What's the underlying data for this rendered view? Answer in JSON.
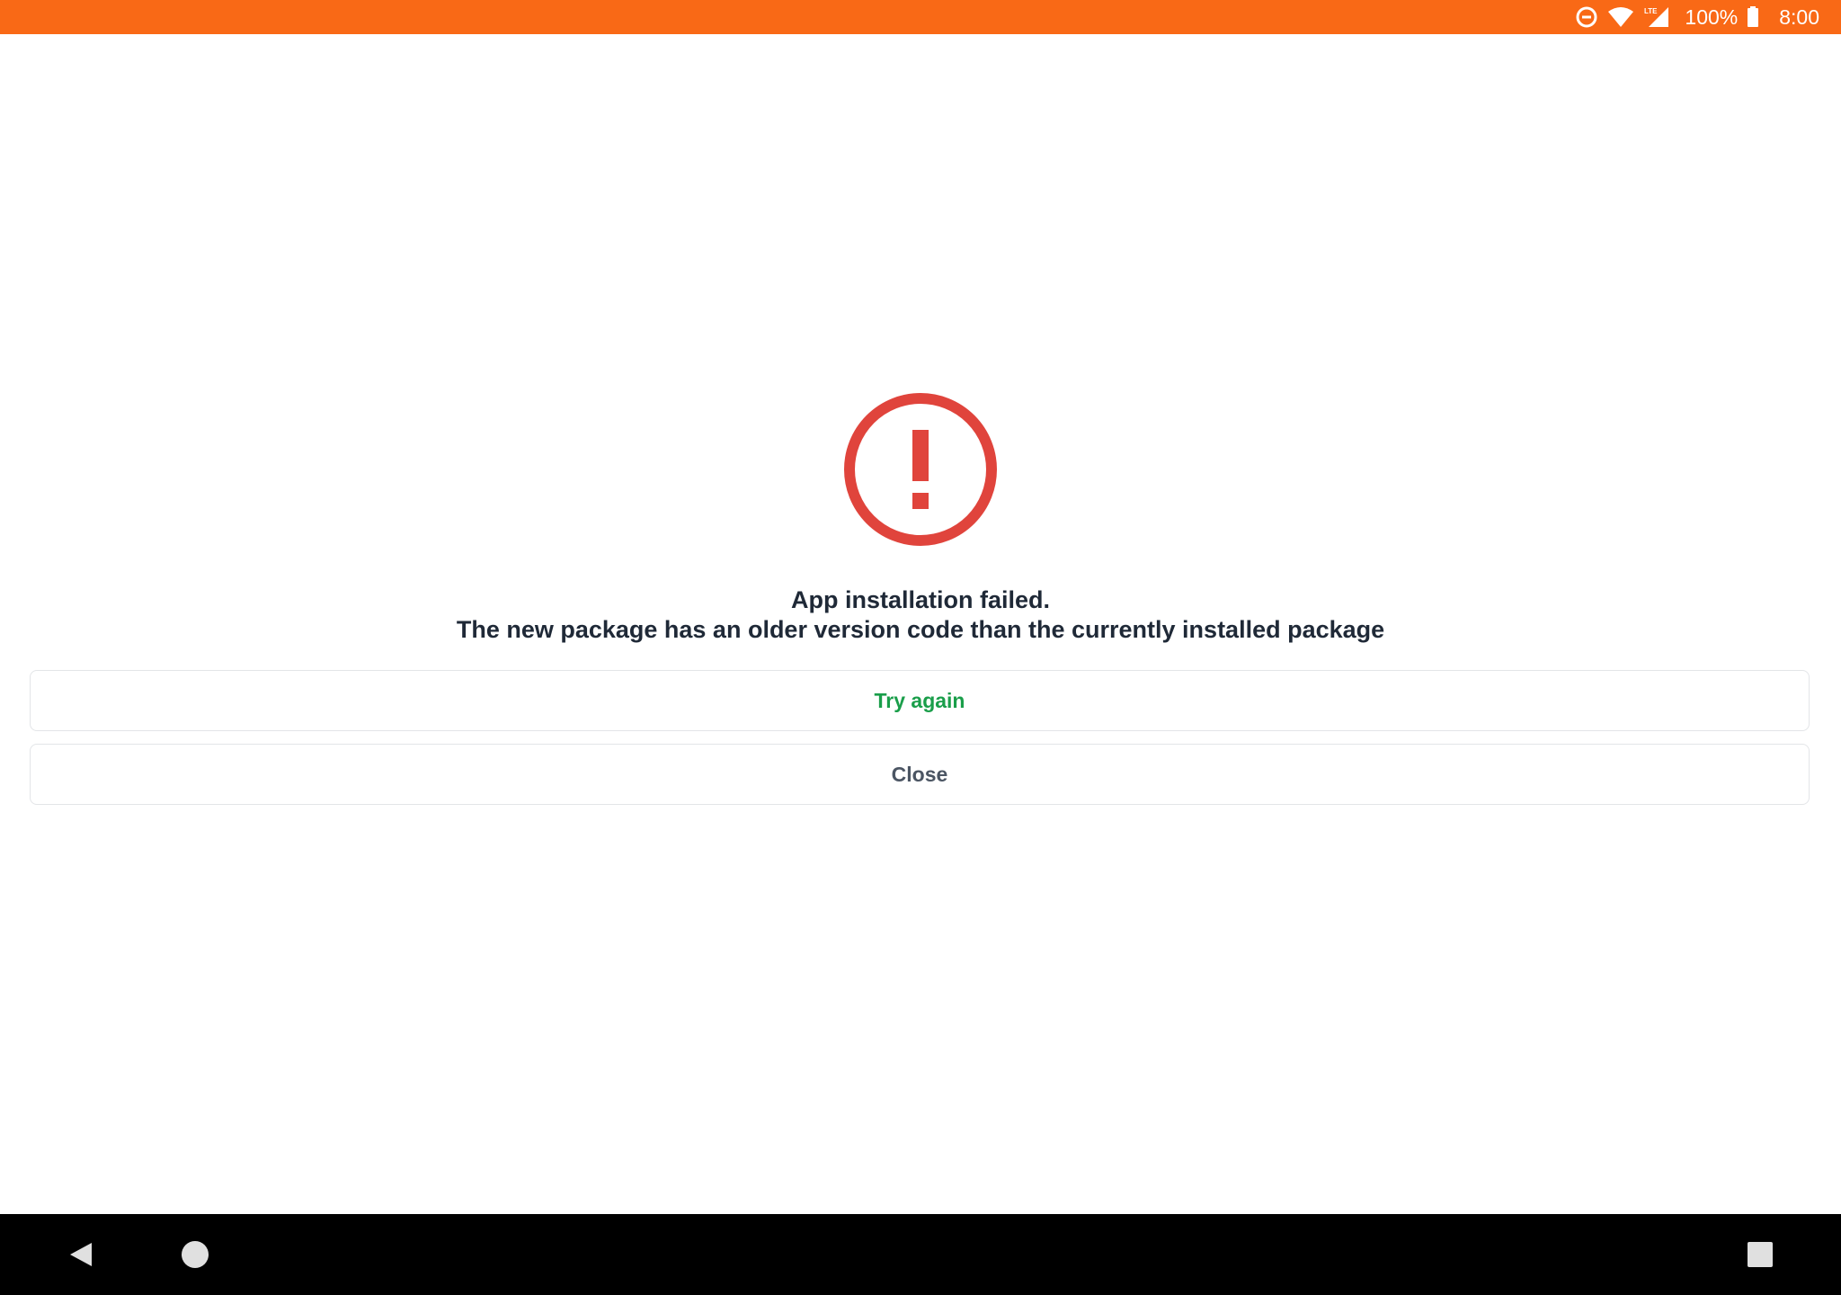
{
  "status_bar": {
    "background_color": "#f96916",
    "icons": [
      "data-saver-icon",
      "wifi-icon",
      "lte-signal-icon",
      "battery-icon"
    ],
    "lte_label": "LTE",
    "battery_percent": "100%",
    "time": "8:00"
  },
  "error": {
    "icon": "alert-circle-icon",
    "icon_color": "#e0443c",
    "title": "App installation failed.",
    "detail": "The new package has an older version code than the currently installed package"
  },
  "buttons": {
    "try_again": "Try again",
    "try_again_color": "#1a9e4a",
    "close": "Close",
    "close_color": "#4b5563"
  },
  "nav_bar": {
    "icons": [
      "back-icon",
      "home-icon",
      "recents-icon"
    ]
  }
}
